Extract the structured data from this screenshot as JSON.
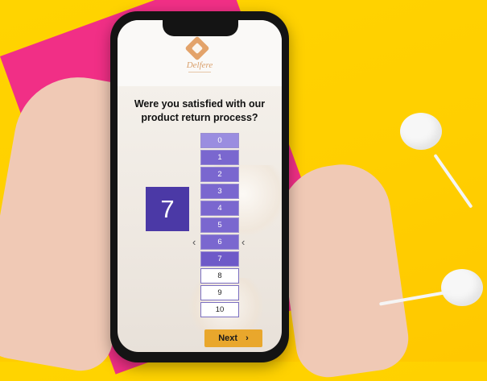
{
  "brand": {
    "name": "Delfere"
  },
  "survey": {
    "question": "Were you satisfied with our product return process?",
    "selected_score": "7",
    "scale": [
      "0",
      "1",
      "2",
      "3",
      "4",
      "5",
      "6",
      "7",
      "8",
      "9",
      "10"
    ],
    "selected_index": 7,
    "next_label": "Next",
    "next_arrow": "›"
  },
  "colors": {
    "background": "#ffd400",
    "pink_accent": "#f12f86",
    "score_box": "#4b39a6",
    "scale_fill": "#7a67cf",
    "next_button": "#e9a72c"
  },
  "icons": {
    "left_chevron": "‹",
    "right_chevron": "‹"
  }
}
